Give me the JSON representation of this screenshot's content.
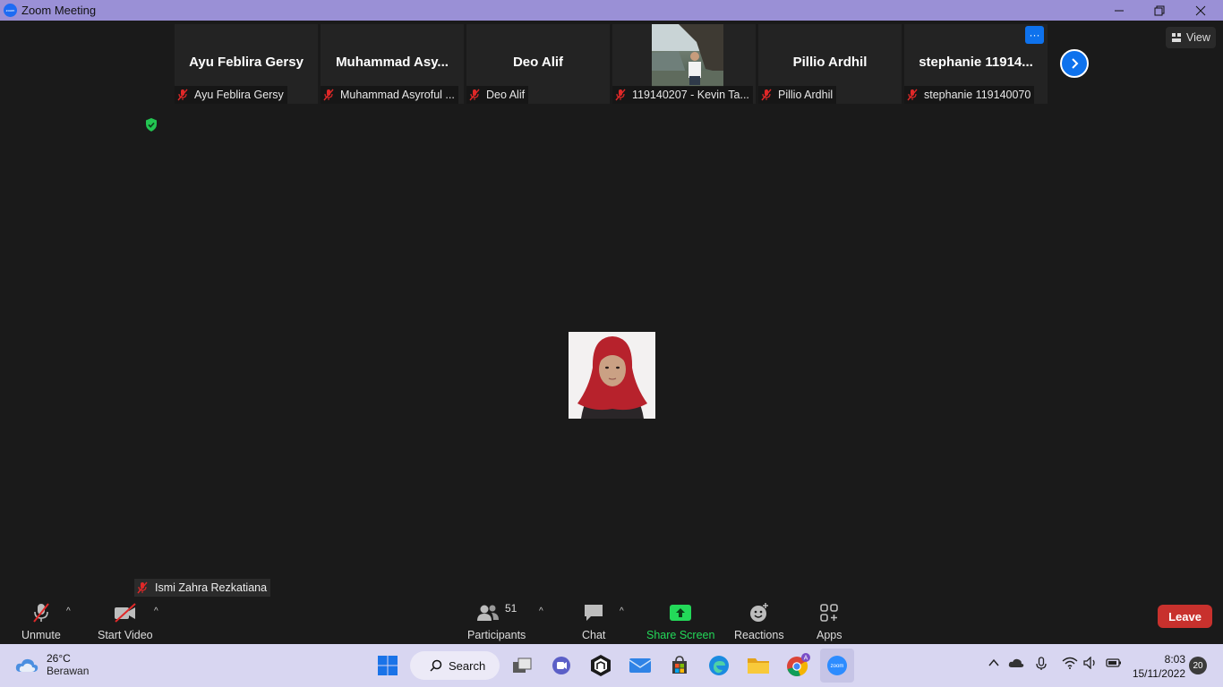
{
  "window": {
    "title": "Zoom Meeting",
    "logo_text": "zoom"
  },
  "gallery": {
    "tiles": [
      {
        "display_name": "Ayu Feblira Gersy",
        "label": "Ayu Feblira Gersy"
      },
      {
        "display_name": "Muhammad  Asy...",
        "label": "Muhammad Asyroful ..."
      },
      {
        "display_name": "Deo Alif",
        "label": "Deo Alif"
      },
      {
        "display_name": "",
        "label": "119140207 - Kevin Ta..."
      },
      {
        "display_name": "Pillio Ardhil",
        "label": "Pillio Ardhil"
      },
      {
        "display_name": "stephanie  11914...",
        "label": "stephanie 119140070"
      }
    ],
    "more_label": "···",
    "view_label": "View"
  },
  "active_speaker": {
    "name": "Ismi Zahra Rezkatiana"
  },
  "toolbar": {
    "unmute": "Unmute",
    "start_video": "Start Video",
    "participants": "Participants",
    "participant_count": "51",
    "chat": "Chat",
    "share_screen": "Share Screen",
    "reactions": "Reactions",
    "apps": "Apps",
    "leave": "Leave",
    "caret": "^"
  },
  "taskbar": {
    "weather_temp": "26°C",
    "weather_desc": "Berawan",
    "search_label": "Search",
    "time": "8:03",
    "date": "15/11/2022",
    "notifications": "20",
    "chrome_badge": "A",
    "zoom_icon_text": "zoom"
  },
  "colors": {
    "accent": "#0e72ed",
    "share_green": "#23d959",
    "leave_red": "#c8312d",
    "titlebar": "#9a90d6"
  }
}
